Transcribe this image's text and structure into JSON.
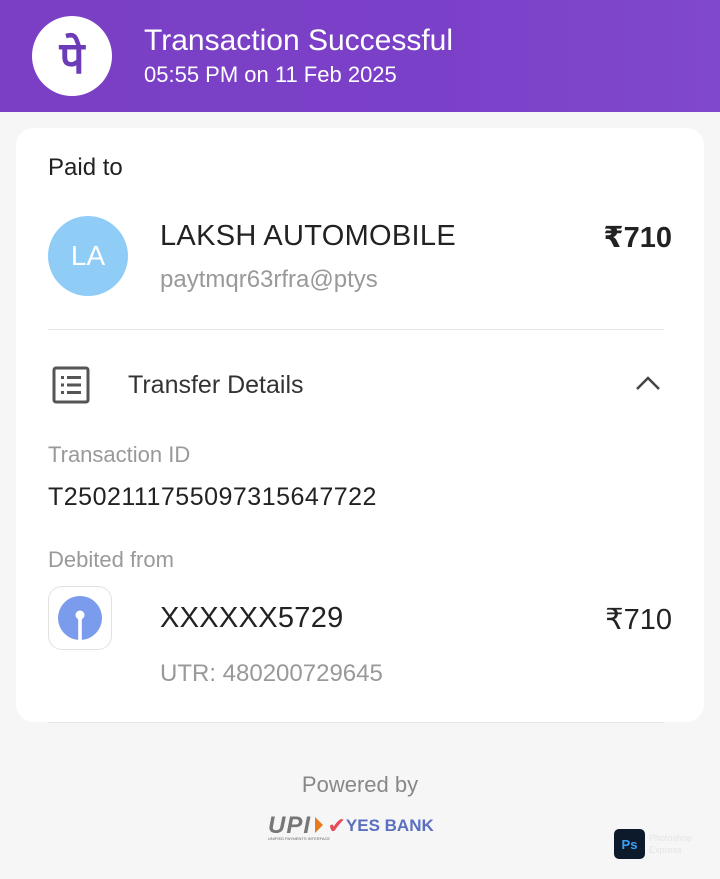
{
  "header": {
    "title": "Transaction Successful",
    "subtitle": "05:55 PM on 11 Feb 2025",
    "logo_glyph": "पे"
  },
  "paid_to": {
    "label": "Paid to",
    "avatar_initials": "LA",
    "name": "LAKSH AUTOMOBILE",
    "upi_id": "paytmqr63rfra@ptys",
    "amount": "₹710"
  },
  "transfer": {
    "label": "Transfer Details",
    "transaction_id_label": "Transaction ID",
    "transaction_id": "T2502111755097315647722",
    "debited_from_label": "Debited from",
    "account": "XXXXXX5729",
    "amount": "₹710",
    "utr": "UTR: 480200729645"
  },
  "footer": {
    "powered_by": "Powered by",
    "upi_logo": "UPI",
    "upi_tagline": "UNIFIED PAYMENTS INTERFACE",
    "bank_logo": "YES BANK",
    "watermark": "Photoshop Express",
    "watermark_ps": "Ps"
  },
  "colors": {
    "brand": "#7a3fc4",
    "avatar": "#8fcdf7",
    "sbi": "#7b9cec"
  }
}
